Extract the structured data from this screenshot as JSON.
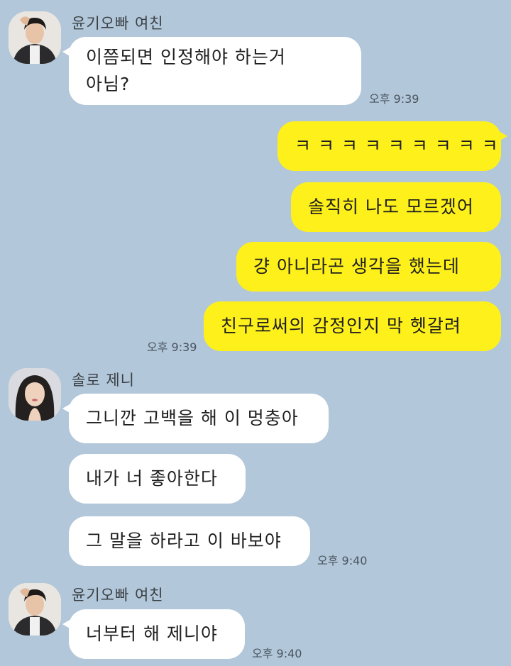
{
  "chat": {
    "group1": {
      "sender": "윤기오빠 여친",
      "messages": [
        "이쯤되면 인정해야 하는거",
        "아님?"
      ],
      "time": "오후 9:39"
    },
    "group2": {
      "messages": [
        "ㅋ ㅋ ㅋ ㅋ ㅋ ㅋ ㅋ ㅋ ㅋ",
        "솔직히 나도 모르겠어",
        "걍 아니라곤 생각을 했는데",
        "친구로써의 감정인지 막 헷갈려"
      ],
      "time": "오후 9:39"
    },
    "group3": {
      "sender": "솔로 제니",
      "messages": [
        "그니깐 고백을 해 이 멍충아",
        "내가 너 좋아한다",
        "그 말을 하라고 이 바보야"
      ],
      "time": "오후 9:40"
    },
    "group4": {
      "sender": "윤기오빠 여친",
      "messages": [
        "너부터 해 제니야"
      ],
      "time": "오후 9:40"
    }
  },
  "colors": {
    "background": "#b2c7d9",
    "incoming_bubble": "#ffffff",
    "outgoing_bubble": "#fef01b"
  }
}
